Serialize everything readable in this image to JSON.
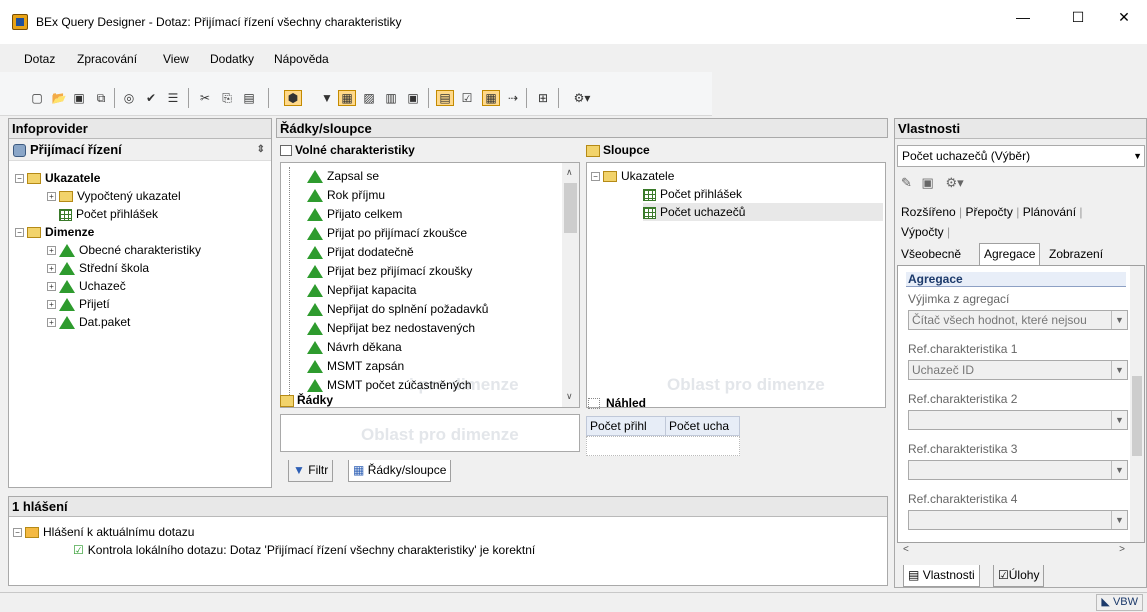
{
  "window": {
    "title": "BEx Query Designer - Dotaz: Přijímací řízení všechny charakteristiky",
    "controls": [
      "—",
      "☐",
      "✕"
    ]
  },
  "menu": [
    "Dotaz",
    "Zpracování",
    "View",
    "Dodatky",
    "Nápověda"
  ],
  "infoprovider": {
    "header": "Infoprovider",
    "name": "Přijímací řízení",
    "tree": [
      {
        "label": "Ukazatele",
        "level": 0,
        "bold": true
      },
      {
        "label": "Vypočtený ukazatel",
        "level": 1
      },
      {
        "label": "Počet přihlášek",
        "level": 1
      },
      {
        "label": "Dimenze",
        "level": 0,
        "bold": true
      },
      {
        "label": "Obecné charakteristiky",
        "level": 1
      },
      {
        "label": "Střední škola",
        "level": 1
      },
      {
        "label": "Uchazeč",
        "level": 1
      },
      {
        "label": "Přijetí",
        "level": 1
      },
      {
        "label": "Dat.paket",
        "level": 1
      }
    ]
  },
  "rows_cols": {
    "header": "Řádky/sloupce",
    "free_header": "Volné charakteristiky",
    "free_items": [
      "Zapsal se",
      "Rok příjmu",
      "Přijato celkem",
      "Přijat po přijímací zkoušce",
      "Přijat dodatečně",
      "Přijat bez přijímací zkoušky",
      "Nepřijat kapacita",
      "Nepřijat do splnění požadavků",
      "Nepřijat bez nedostavených",
      "Návrh děkana",
      "MSMT zapsán",
      "MSMT počet zúčastněných"
    ],
    "columns_header": "Sloupce",
    "columns_tree": [
      {
        "label": "Ukazatele",
        "level": 0
      },
      {
        "label": "Počet přihlášek",
        "level": 1
      },
      {
        "label": "Počet uchazečů",
        "level": 1
      }
    ],
    "rows_header": "Řádky",
    "preview_header": "Náhled",
    "preview_cols": [
      "Počet přihl",
      "Počet ucha"
    ],
    "placeholder": "Oblast pro dimenze",
    "placeholder_partial": "i pro dimenze",
    "tabs": [
      "Filtr",
      "Řádky/sloupce"
    ]
  },
  "messages": {
    "header": "1 hlášení",
    "root": "Hlášení k aktuálnímu dotazu",
    "item": "Kontrola lokálního dotazu: Dotaz 'Přijímací řízení všechny charakteristiky' je korektní"
  },
  "properties": {
    "header": "Vlastnosti",
    "selected": "Počet uchazečů (Výběr)",
    "tabs_row1": [
      "Rozšířeno",
      "Přepočty",
      "Plánování",
      "Výpočty"
    ],
    "tabs_row2": [
      "Všeobecně",
      "Agregace",
      "Zobrazení"
    ],
    "active_tab": "Agregace",
    "section": "Agregace",
    "fields": [
      {
        "label": "Výjimka z agregací",
        "value": "Čítač všech hodnot, které nejsou"
      },
      {
        "label": "Ref.charakteristika 1",
        "value": "Uchazeč ID"
      },
      {
        "label": "Ref.charakteristika 2",
        "value": ""
      },
      {
        "label": "Ref.charakteristika 3",
        "value": ""
      },
      {
        "label": "Ref.charakteristika 4",
        "value": ""
      }
    ],
    "bottom_tabs": [
      "Vlastnosti",
      "Úlohy"
    ]
  },
  "status": {
    "right": "VBW"
  },
  "colors": {
    "accent": "#ffd98a",
    "tree_green": "#2e9b2e",
    "placeholder": "#e3e6ea"
  }
}
